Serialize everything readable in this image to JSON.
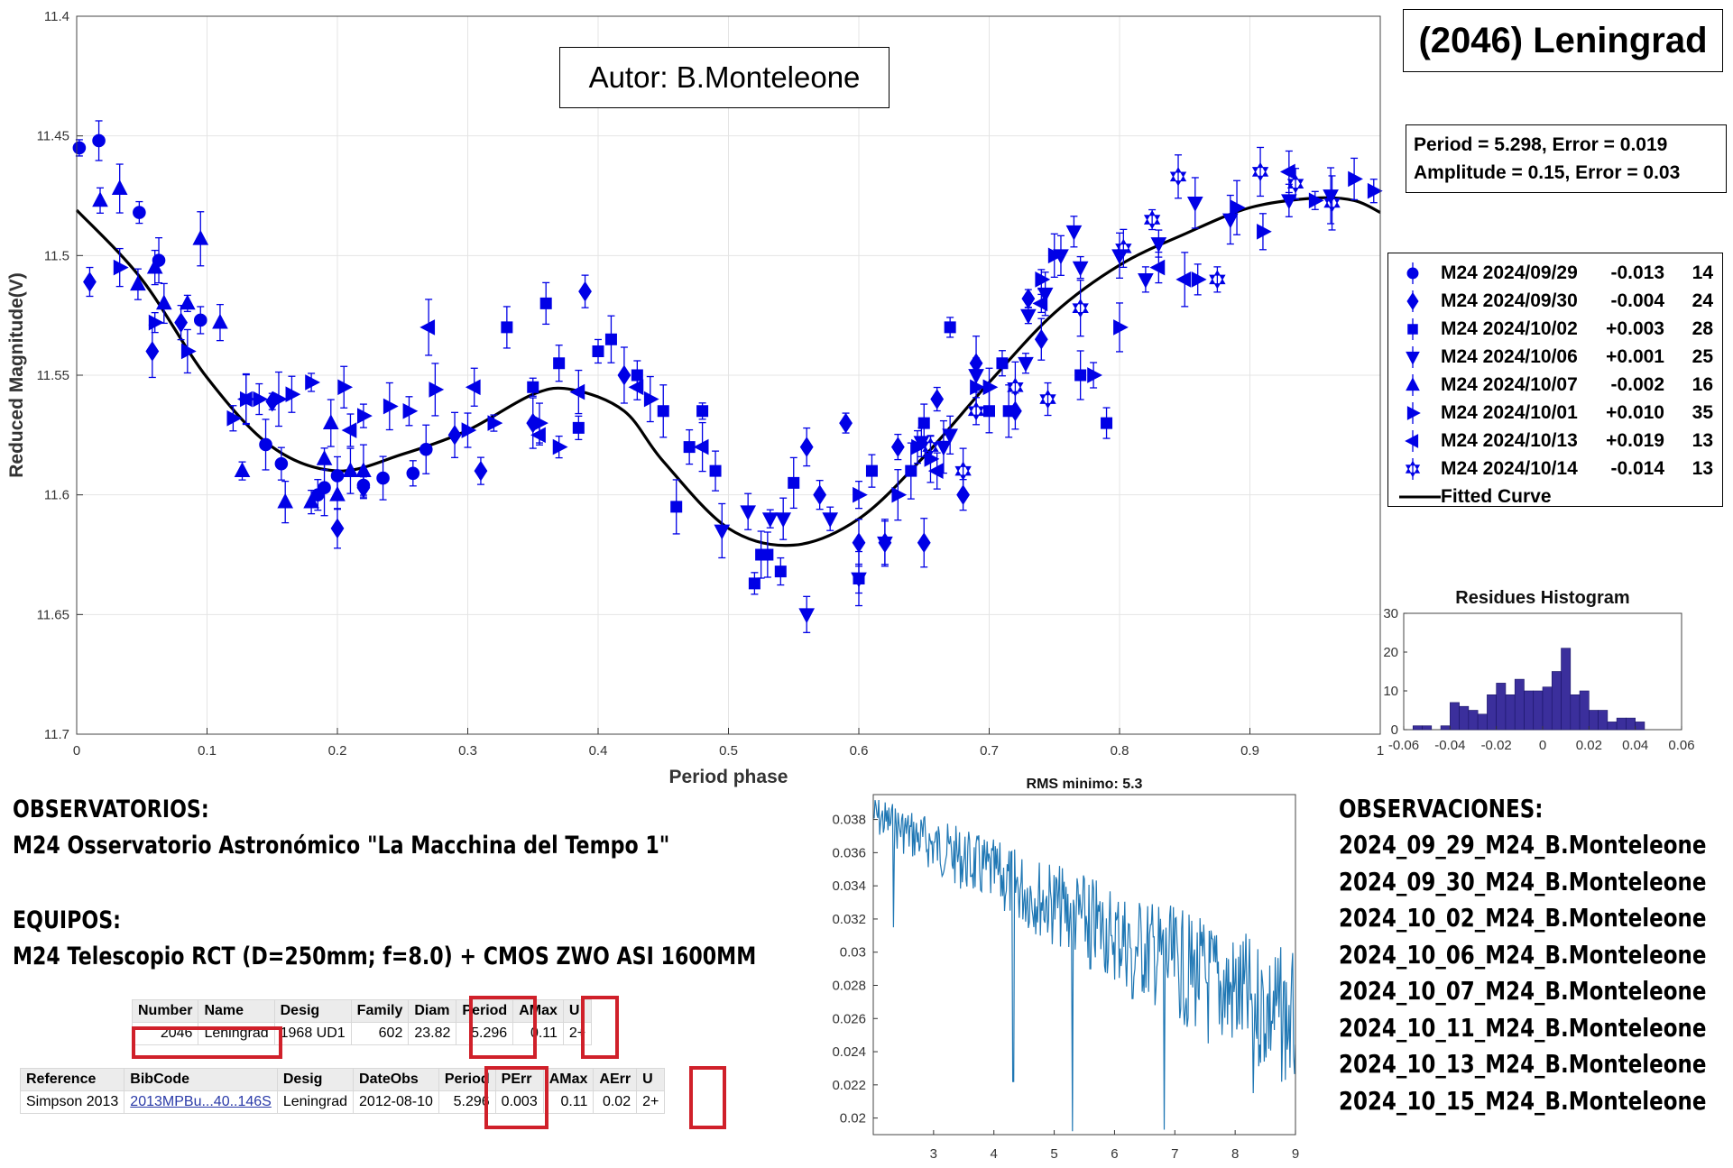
{
  "chart_data": [
    {
      "type": "scatter",
      "ylabel": "Reduced Magnitude(V)",
      "xlabel": "Period phase",
      "xlim": [
        0,
        1
      ],
      "ylim": [
        11.4,
        11.7
      ],
      "y_reversed": true,
      "xticks": [
        "0",
        "0.1",
        "0.2",
        "0.3",
        "0.4",
        "0.5",
        "0.6",
        "0.7",
        "0.8",
        "0.9",
        "1"
      ],
      "yticks": [
        "11.4",
        "11.45",
        "11.5",
        "11.55",
        "11.6",
        "11.65",
        "11.7"
      ],
      "grid": true,
      "legend_position": "right",
      "marker_color": "#0000e6",
      "series": [
        {
          "name": "M24 2024/09/29",
          "offset": "-0.013",
          "count": "14",
          "marker": "circle",
          "points": [
            [
              0.002,
              11.455
            ],
            [
              0.017,
              11.452
            ],
            [
              0.048,
              11.482
            ],
            [
              0.063,
              11.502
            ],
            [
              0.095,
              11.527
            ],
            [
              0.145,
              11.579
            ],
            [
              0.157,
              11.587
            ],
            [
              0.19,
              11.597
            ],
            [
              0.2,
              11.592
            ],
            [
              0.22,
              11.596
            ],
            [
              0.235,
              11.593
            ],
            [
              0.258,
              11.591
            ],
            [
              0.268,
              11.581
            ],
            [
              0.185,
              11.6
            ]
          ]
        },
        {
          "name": "M24 2024/09/30",
          "offset": "-0.004",
          "count": "24",
          "marker": "diamond",
          "points": [
            [
              0.01,
              11.511
            ],
            [
              0.058,
              11.54
            ],
            [
              0.08,
              11.528
            ],
            [
              0.15,
              11.561
            ],
            [
              0.2,
              11.614
            ],
            [
              0.22,
              11.597
            ],
            [
              0.29,
              11.575
            ],
            [
              0.31,
              11.59
            ],
            [
              0.35,
              11.57
            ],
            [
              0.39,
              11.515
            ],
            [
              0.42,
              11.55
            ],
            [
              0.56,
              11.58
            ],
            [
              0.59,
              11.57
            ],
            [
              0.62,
              11.62
            ],
            [
              0.63,
              11.58
            ],
            [
              0.65,
              11.62
            ],
            [
              0.68,
              11.6
            ],
            [
              0.69,
              11.545
            ],
            [
              0.72,
              11.565
            ],
            [
              0.73,
              11.518
            ],
            [
              0.74,
              11.535
            ],
            [
              0.66,
              11.56
            ],
            [
              0.6,
              11.62
            ],
            [
              0.57,
              11.6
            ]
          ]
        },
        {
          "name": "M24 2024/10/02",
          "offset": "+0.003",
          "count": "28",
          "marker": "square",
          "points": [
            [
              0.36,
              11.52
            ],
            [
              0.4,
              11.54
            ],
            [
              0.41,
              11.535
            ],
            [
              0.43,
              11.55
            ],
            [
              0.45,
              11.565
            ],
            [
              0.47,
              11.58
            ],
            [
              0.48,
              11.565
            ],
            [
              0.49,
              11.59
            ],
            [
              0.52,
              11.637
            ],
            [
              0.53,
              11.625
            ],
            [
              0.54,
              11.632
            ],
            [
              0.55,
              11.595
            ],
            [
              0.61,
              11.59
            ],
            [
              0.64,
              11.59
            ],
            [
              0.65,
              11.57
            ],
            [
              0.67,
              11.53
            ],
            [
              0.7,
              11.565
            ],
            [
              0.71,
              11.545
            ],
            [
              0.77,
              11.55
            ],
            [
              0.79,
              11.57
            ],
            [
              0.46,
              11.605
            ],
            [
              0.37,
              11.545
            ],
            [
              0.35,
              11.555
            ],
            [
              0.33,
              11.53
            ],
            [
              0.385,
              11.572
            ],
            [
              0.525,
              11.625
            ],
            [
              0.6,
              11.635
            ],
            [
              0.715,
              11.565
            ]
          ]
        },
        {
          "name": "M24 2024/10/06",
          "offset": "+0.001",
          "count": "25",
          "marker": "triangle-down",
          "points": [
            [
              0.495,
              11.615
            ],
            [
              0.515,
              11.607
            ],
            [
              0.532,
              11.61
            ],
            [
              0.542,
              11.61
            ],
            [
              0.578,
              11.61
            ],
            [
              0.62,
              11.62
            ],
            [
              0.648,
              11.578
            ],
            [
              0.665,
              11.58
            ],
            [
              0.69,
              11.55
            ],
            [
              0.73,
              11.525
            ],
            [
              0.755,
              11.5
            ],
            [
              0.77,
              11.505
            ],
            [
              0.8,
              11.5
            ],
            [
              0.83,
              11.495
            ],
            [
              0.858,
              11.478
            ],
            [
              0.93,
              11.477
            ],
            [
              0.962,
              11.475
            ],
            [
              0.67,
              11.575
            ],
            [
              0.728,
              11.545
            ],
            [
              0.743,
              11.516
            ],
            [
              0.82,
              11.51
            ],
            [
              0.885,
              11.485
            ],
            [
              0.765,
              11.49
            ],
            [
              0.6,
              11.635
            ],
            [
              0.56,
              11.65
            ]
          ]
        },
        {
          "name": "M24 2024/10/07",
          "offset": "-0.002",
          "count": "16",
          "marker": "triangle-up",
          "points": [
            [
              0.018,
              11.477
            ],
            [
              0.033,
              11.472
            ],
            [
              0.047,
              11.512
            ],
            [
              0.095,
              11.493
            ],
            [
              0.11,
              11.528
            ],
            [
              0.127,
              11.59
            ],
            [
              0.16,
              11.603
            ],
            [
              0.18,
              11.603
            ],
            [
              0.195,
              11.57
            ],
            [
              0.2,
              11.6
            ],
            [
              0.22,
              11.59
            ],
            [
              0.06,
              11.505
            ],
            [
              0.085,
              11.52
            ],
            [
              0.067,
              11.52
            ],
            [
              0.19,
              11.585
            ],
            [
              0.21,
              11.59
            ]
          ]
        },
        {
          "name": "M24 2024/10/01",
          "offset": "+0.010",
          "count": "35",
          "marker": "triangle-right",
          "points": [
            [
              0.033,
              11.505
            ],
            [
              0.06,
              11.528
            ],
            [
              0.085,
              11.54
            ],
            [
              0.12,
              11.568
            ],
            [
              0.13,
              11.56
            ],
            [
              0.14,
              11.56
            ],
            [
              0.155,
              11.56
            ],
            [
              0.165,
              11.558
            ],
            [
              0.18,
              11.553
            ],
            [
              0.205,
              11.555
            ],
            [
              0.22,
              11.567
            ],
            [
              0.24,
              11.563
            ],
            [
              0.255,
              11.565
            ],
            [
              0.275,
              11.556
            ],
            [
              0.3,
              11.573
            ],
            [
              0.32,
              11.57
            ],
            [
              0.355,
              11.57
            ],
            [
              0.37,
              11.58
            ],
            [
              0.44,
              11.56
            ],
            [
              0.6,
              11.6
            ],
            [
              0.63,
              11.6
            ],
            [
              0.645,
              11.58
            ],
            [
              0.69,
              11.555
            ],
            [
              0.7,
              11.555
            ],
            [
              0.74,
              11.51
            ],
            [
              0.75,
              11.5
            ],
            [
              0.78,
              11.55
            ],
            [
              0.8,
              11.53
            ],
            [
              0.86,
              11.51
            ],
            [
              0.89,
              11.48
            ],
            [
              0.91,
              11.49
            ],
            [
              0.95,
              11.477
            ],
            [
              0.98,
              11.468
            ],
            [
              0.995,
              11.473
            ],
            [
              0.655,
              11.585
            ]
          ]
        },
        {
          "name": "M24 2024/10/13",
          "offset": "+0.019",
          "count": "13",
          "marker": "triangle-left",
          "points": [
            [
              0.13,
              11.56
            ],
            [
              0.21,
              11.573
            ],
            [
              0.27,
              11.53
            ],
            [
              0.305,
              11.555
            ],
            [
              0.355,
              11.575
            ],
            [
              0.385,
              11.557
            ],
            [
              0.43,
              11.555
            ],
            [
              0.48,
              11.58
            ],
            [
              0.83,
              11.505
            ],
            [
              0.85,
              11.51
            ],
            [
              0.66,
              11.59
            ],
            [
              0.74,
              11.52
            ],
            [
              0.93,
              11.465
            ]
          ]
        },
        {
          "name": "M24 2024/10/14",
          "offset": "-0.014",
          "count": "13",
          "marker": "hexagram",
          "points": [
            [
              0.655,
              11.58
            ],
            [
              0.68,
              11.59
            ],
            [
              0.69,
              11.565
            ],
            [
              0.72,
              11.555
            ],
            [
              0.745,
              11.56
            ],
            [
              0.77,
              11.522
            ],
            [
              0.803,
              11.497
            ],
            [
              0.825,
              11.485
            ],
            [
              0.845,
              11.467
            ],
            [
              0.875,
              11.51
            ],
            [
              0.908,
              11.465
            ],
            [
              0.935,
              11.47
            ],
            [
              0.963,
              11.478
            ]
          ]
        }
      ],
      "fitted_curve": {
        "name": "Fitted Curve",
        "x": [
          0,
          0.05,
          0.1,
          0.15,
          0.2,
          0.25,
          0.3,
          0.35,
          0.38,
          0.42,
          0.45,
          0.5,
          0.55,
          0.6,
          0.65,
          0.7,
          0.75,
          0.8,
          0.85,
          0.9,
          0.95,
          0.98,
          1.0
        ],
        "y": [
          11.481,
          11.51,
          11.551,
          11.58,
          11.59,
          11.583,
          11.573,
          11.558,
          11.556,
          11.565,
          11.586,
          11.614,
          11.621,
          11.61,
          11.584,
          11.553,
          11.524,
          11.504,
          11.491,
          11.48,
          11.476,
          11.477,
          11.482
        ]
      }
    },
    {
      "type": "bar",
      "title": "Residues Histogram",
      "xlim": [
        -0.06,
        0.06
      ],
      "ylim": [
        0,
        30
      ],
      "xticks": [
        "-0.06",
        "-0.04",
        "-0.02",
        "0",
        "0.02",
        "0.04",
        "0.06"
      ],
      "yticks": [
        "0",
        "10",
        "20",
        "30"
      ],
      "bar_color": "#3b2f9c",
      "bin_width": 0.004,
      "bins": [
        -0.054,
        -0.05,
        -0.046,
        -0.042,
        -0.038,
        -0.034,
        -0.03,
        -0.026,
        -0.022,
        -0.018,
        -0.014,
        -0.01,
        -0.006,
        -0.002,
        0.002,
        0.006,
        0.01,
        0.014,
        0.018,
        0.022,
        0.026,
        0.03,
        0.034,
        0.038,
        0.042
      ],
      "values": [
        1,
        1,
        0,
        1,
        7,
        6,
        5,
        4,
        9,
        12,
        9,
        13,
        10,
        10,
        11,
        15,
        21,
        9,
        10,
        5,
        5,
        2,
        3,
        3,
        2
      ]
    },
    {
      "type": "line",
      "title": "RMS minimo: 5.3",
      "xlim": [
        2,
        9
      ],
      "ylim": [
        0.019,
        0.0395
      ],
      "xticks": [
        "3",
        "4",
        "5",
        "6",
        "7",
        "8",
        "9"
      ],
      "yticks": [
        "0.02",
        "0.022",
        "0.024",
        "0.026",
        "0.028",
        "0.03",
        "0.032",
        "0.034",
        "0.036",
        "0.038"
      ],
      "line_color": "#1f77b4",
      "seed": 7,
      "dips": [
        [
          2.34,
          0.0315
        ],
        [
          4.32,
          0.0222
        ],
        [
          5.3,
          0.0192
        ],
        [
          5.6,
          0.029
        ],
        [
          5.95,
          0.031
        ],
        [
          6.3,
          0.0272
        ],
        [
          6.82,
          0.0193
        ],
        [
          7.2,
          0.0255
        ],
        [
          7.56,
          0.0245
        ],
        [
          8.3,
          0.0215
        ],
        [
          8.62,
          0.0275
        ],
        [
          8.92,
          0.0268
        ]
      ]
    }
  ],
  "title": {
    "author": "Autor: B.Monteleone",
    "object": "(2046) Leningrad"
  },
  "stats": {
    "period_line": "Period =  5.298, Error = 0.019",
    "amplitude_line": "Amplitude = 0.15, Error = 0.03"
  },
  "info": {
    "obs_title": "OBSERVATORIOS:",
    "obs_line": "M24 Osservatorio Astronómico \"La Macchina del Tempo 1\"",
    "eq_title": "EQUIPOS:",
    "eq_line": "M24 Telescopio RCT (D=250mm; f=8.0) + CMOS ZWO ASI 1600MM"
  },
  "observations": {
    "title": "OBSERVACIONES:",
    "items": [
      "2024_09_29_M24_B.Monteleone",
      "2024_09_30_M24_B.Monteleone",
      "2024_10_02_M24_B.Monteleone",
      "2024_10_06_M24_B.Monteleone",
      "2024_10_07_M24_B.Monteleone",
      "2024_10_11_M24_B.Monteleone",
      "2024_10_13_M24_B.Monteleone",
      "2024_10_15_M24_B.Monteleone"
    ]
  },
  "table1": {
    "headers": [
      "Number",
      "Name",
      "Desig",
      "Family",
      "Diam",
      "Period",
      "AMax",
      "U"
    ],
    "row": [
      "2046",
      "Leningrad",
      "1968 UD1",
      "602",
      "23.82",
      "5.296",
      "0.11",
      "2+"
    ]
  },
  "table2": {
    "headers": [
      "Reference",
      "BibCode",
      "Desig",
      "DateObs",
      "Period",
      "PErr",
      "AMax",
      "AErr",
      "U"
    ],
    "row": [
      "Simpson 2013",
      "2013MPBu...40..146S",
      "Leningrad",
      "2012-08-10",
      "5.296",
      "0.003",
      "0.11",
      "0.02",
      "2+"
    ]
  }
}
